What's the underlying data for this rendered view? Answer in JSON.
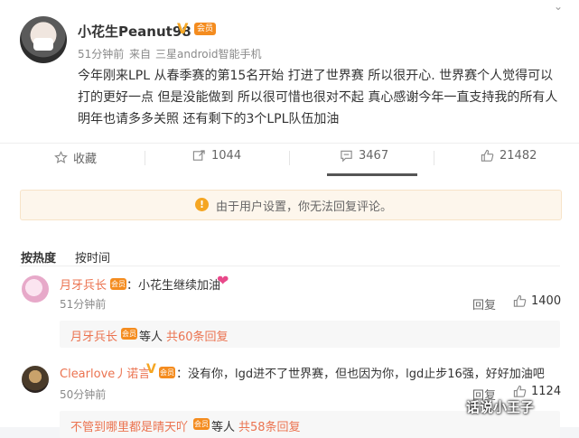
{
  "post": {
    "username": "小花生Peanut98",
    "verified_mark": "V",
    "badge": "会员",
    "time": "51分钟前",
    "from_label": "来自",
    "device": "三星android智能手机",
    "text": "今年刚来LPL 从春季赛的第15名开始 打进了世界赛 所以很开心. 世界赛个人觉得可以打的更好一点 但是没能做到 所以很可惜也很对不起 真心感谢今年一直支持我的所有人 明年也请多多关照 还有剩下的3个LPL队伍加油",
    "menu_glyph": "⌄"
  },
  "actions": {
    "collect": "收藏",
    "forward": "1044",
    "comment": "3467",
    "like": "21482"
  },
  "notice": {
    "icon": "!",
    "text": "由于用户设置，你无法回复评论。"
  },
  "sort": {
    "hot": "按热度",
    "time": "按时间"
  },
  "comments": [
    {
      "name": "月牙兵长",
      "badge": "会员",
      "text": "：小花生继续加油",
      "emoji": "❤",
      "time": "51分钟前",
      "reply_label": "回复",
      "likes": "1400",
      "sub": {
        "name": "月牙兵长",
        "badge": "会员",
        "others": "等人",
        "count": "共60条回复"
      }
    },
    {
      "name": "Clearlove丿诺言",
      "verified_mark": "V",
      "badge": "会员",
      "text": "：没有你，lgd进不了世界赛，但也因为你，lgd止步16强，好好加油吧",
      "time": "50分钟前",
      "reply_label": "回复",
      "likes": "1124",
      "sub": {
        "name": "不管到哪里都是晴天吖",
        "badge": "会员",
        "others": "等人",
        "count": "共58条回复"
      }
    }
  ],
  "watermark": "话说小王子"
}
